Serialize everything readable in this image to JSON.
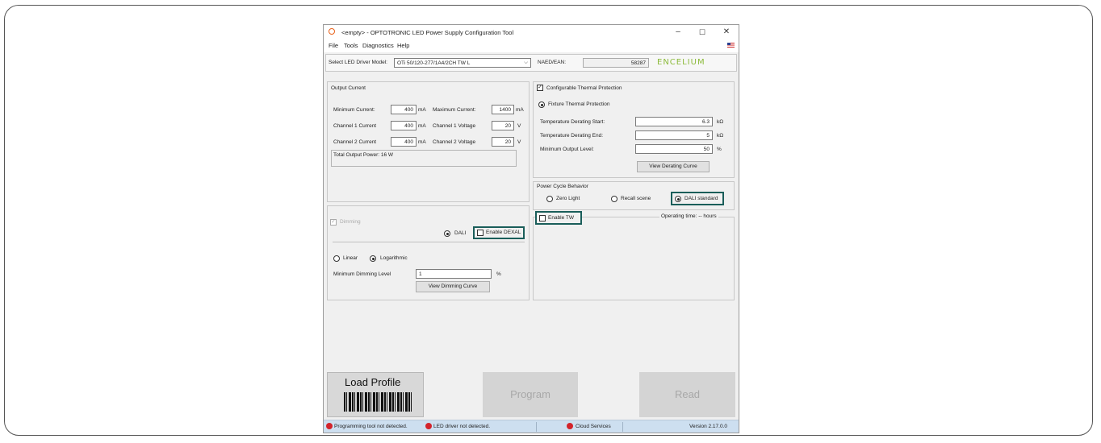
{
  "window": {
    "title": "<empty> - OPTOTRONIC LED Power Supply Configuration Tool",
    "controls": {
      "minimize": "–",
      "maximize": "☐",
      "close": "✕"
    }
  },
  "menu": {
    "items": [
      "File",
      "Tools",
      "Diagnostics",
      "Help"
    ]
  },
  "driver": {
    "model_label": "Select LED Driver Model:",
    "model_value": "OTi 50/120-277/1A4/2CH TW L",
    "ean_label": "NAED/EAN:",
    "ean_value": "58287",
    "brand": "ENCELIUM"
  },
  "output_current": {
    "title": "Output Current",
    "minimum_label": "Minimum Current:",
    "minimum_value": "400",
    "minimum_unit": "mA",
    "maximum_label": "Maximum Current:",
    "maximum_value": "1400",
    "maximum_unit": "mA",
    "ch1_current_label": "Channel 1 Current",
    "ch1_current_value": "400",
    "ch1_current_unit": "mA",
    "ch1_voltage_label": "Channel 1 Voltage",
    "ch1_voltage_value": "20",
    "ch1_voltage_unit": "V",
    "ch2_current_label": "Channel 2 Current",
    "ch2_current_value": "400",
    "ch2_current_unit": "mA",
    "ch2_voltage_label": "Channel 2 Voltage",
    "ch2_voltage_value": "20",
    "ch2_voltage_unit": "V",
    "total_power": "Total Output Power: 16 W"
  },
  "thermal": {
    "title": "Configurable Thermal Protection",
    "checked": true,
    "fixture_label": "Fixture Thermal Protection",
    "start_label": "Temperature Derating Start:",
    "start_value": "6.3",
    "start_unit": "kΩ",
    "end_label": "Temperature Derating End:",
    "end_value": "5",
    "end_unit": "kΩ",
    "min_output_label": "Minimum Output Level:",
    "min_output_value": "50",
    "min_output_unit": "%",
    "curve_button": "View Derating Curve"
  },
  "power_cycle": {
    "title": "Power Cycle Behavior",
    "options": [
      "Zero Light",
      "Recall scene",
      "DALI standard"
    ],
    "selected": "DALI standard"
  },
  "dimming": {
    "title": "Dimming",
    "dali_label": "DALI",
    "dexal_label": "Enable DEXAL",
    "linear_label": "Linear",
    "log_label": "Logarithmic",
    "min_level_label": "Minimum Dimming Level",
    "min_level_value": "1",
    "min_level_unit": "%",
    "curve_button": "View Dimming Curve"
  },
  "tw": {
    "enable_label": "Enable TW",
    "operating_time": "Operating time:  -- hours"
  },
  "actions": {
    "load_profile": "Load Profile",
    "program": "Program",
    "read": "Read"
  },
  "status": {
    "tool": "Programming tool not detected.",
    "driver": "LED driver not detected.",
    "cloud": "Cloud Services",
    "version": "Version 2.17.0.0"
  },
  "colors": {
    "highlight": "#1a5e5a",
    "brand": "#8dbb3c",
    "status_error": "#d3232b",
    "status_bar": "#cddff0"
  }
}
